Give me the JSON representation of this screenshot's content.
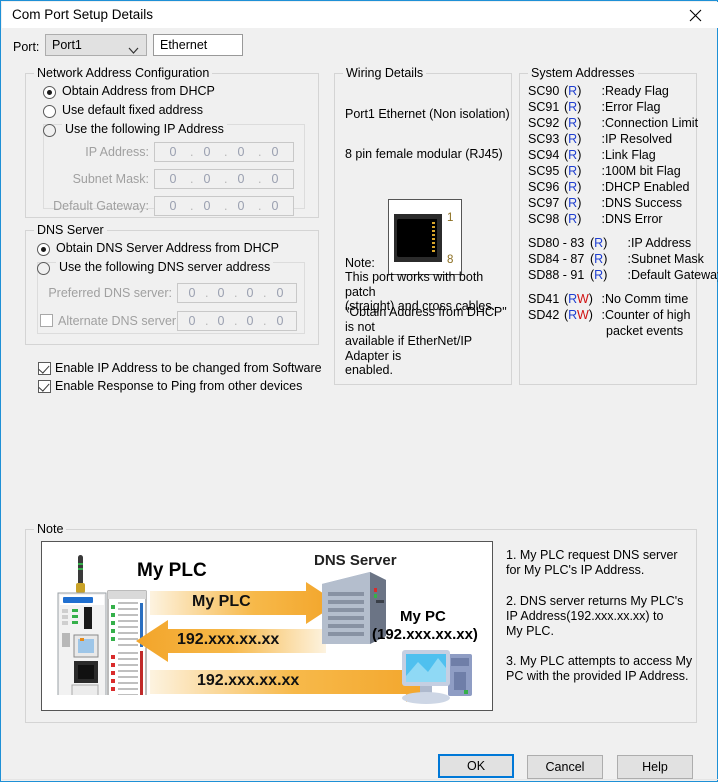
{
  "window": {
    "title": "Com Port Setup Details",
    "close_icon": "close-icon"
  },
  "port_row": {
    "label": "Port:",
    "selected_port": "Port1",
    "port_options": [
      "Port1"
    ],
    "port_name": "Ethernet"
  },
  "network": {
    "legend": "Network Address Configuration",
    "options": [
      {
        "label": "Obtain Address from DHCP",
        "checked": true
      },
      {
        "label": "Use default fixed address",
        "checked": false
      },
      {
        "label": "Use the following IP Address",
        "checked": false
      }
    ],
    "fields": [
      {
        "label": "IP Address:",
        "value": "0 . 0 . 0 . 0",
        "octets": [
          "0",
          "0",
          "0",
          "0"
        ],
        "disabled": true
      },
      {
        "label": "Subnet Mask:",
        "value": "0 . 0 . 0 . 0",
        "octets": [
          "0",
          "0",
          "0",
          "0"
        ],
        "disabled": true
      },
      {
        "label": "Default Gateway:",
        "value": "0 . 0 . 0 . 0",
        "octets": [
          "0",
          "0",
          "0",
          "0"
        ],
        "disabled": true
      }
    ]
  },
  "dns": {
    "legend": "DNS Server",
    "options": [
      {
        "label": "Obtain DNS Server Address from DHCP",
        "checked": true
      },
      {
        "label": "Use the following DNS server address",
        "checked": false
      }
    ],
    "preferred_label": "Preferred DNS server:",
    "preferred_value": "0 . 0 . 0 . 0",
    "alternate_label": "Alternate DNS server:",
    "alternate_checked": false,
    "alternate_value": "0 . 0 . 0 . 0"
  },
  "checkboxes": [
    {
      "label": "Enable IP Address to be changed from Software",
      "checked": true
    },
    {
      "label": "Enable Response to Ping from other devices",
      "checked": true
    }
  ],
  "wiring": {
    "legend": "Wiring Details",
    "line1": "Port1 Ethernet (Non isolation)",
    "line2": "8 pin female modular (RJ45)",
    "pin_top": "1",
    "pin_bottom": "8",
    "note_title": "Note:",
    "note_body": "This port works with both patch\n(straight) and cross cables.",
    "note_body2": "\"Obtain Address from DHCP\" is not\navailable if EtherNet/IP Adapter is\nenabled."
  },
  "system_addresses": {
    "legend": "System Addresses",
    "rows": [
      {
        "addr": "SC90",
        "access": "R",
        "desc": ":Ready Flag"
      },
      {
        "addr": "SC91",
        "access": "R",
        "desc": ":Error Flag"
      },
      {
        "addr": "SC92",
        "access": "R",
        "desc": ":Connection Limit"
      },
      {
        "addr": "SC93",
        "access": "R",
        "desc": ":IP Resolved"
      },
      {
        "addr": "SC94",
        "access": "R",
        "desc": ":Link Flag"
      },
      {
        "addr": "SC95",
        "access": "R",
        "desc": ":100M bit Flag"
      },
      {
        "addr": "SC96",
        "access": "R",
        "desc": ":DHCP Enabled"
      },
      {
        "addr": "SC97",
        "access": "R",
        "desc": ":DNS Success"
      },
      {
        "addr": "SC98",
        "access": "R",
        "desc": ":DNS Error"
      },
      {
        "addr": "SD80 - 83",
        "access": "R",
        "desc": ":IP Address"
      },
      {
        "addr": "SD84 - 87",
        "access": "R",
        "desc": ":Subnet Mask"
      },
      {
        "addr": "SD88 - 91",
        "access": "R",
        "desc": ":Default Gateway"
      },
      {
        "addr": "SD41",
        "access": "RW",
        "desc": ":No Comm time"
      },
      {
        "addr": "SD42",
        "access": "RW",
        "desc": ":Counter of high"
      }
    ],
    "continuation": "packet events",
    "color_read": "#1f3fd0",
    "color_write": "#d01010"
  },
  "note": {
    "legend": "Note",
    "diagram": {
      "plc_label": "My PLC",
      "dns_label": "DNS Server",
      "pc_label": "My PC",
      "pc_ip": "(192.xxx.xx.xx)",
      "arrow1_text": "My PLC",
      "arrow2_text": "192.xxx.xx.xx",
      "arrow3_text": "192.xxx.xx.xx",
      "arrow_color": "#f2a429"
    },
    "steps": [
      "1. My PLC request DNS server\nfor My PLC's IP Address.",
      "2. DNS server returns My PLC's\nIP Address(192.xxx.xx.xx) to\nMy PLC.",
      "3. My PLC attempts to access My\nPC with the provided IP Address."
    ]
  },
  "buttons": {
    "ok": "OK",
    "cancel": "Cancel",
    "help": "Help"
  }
}
